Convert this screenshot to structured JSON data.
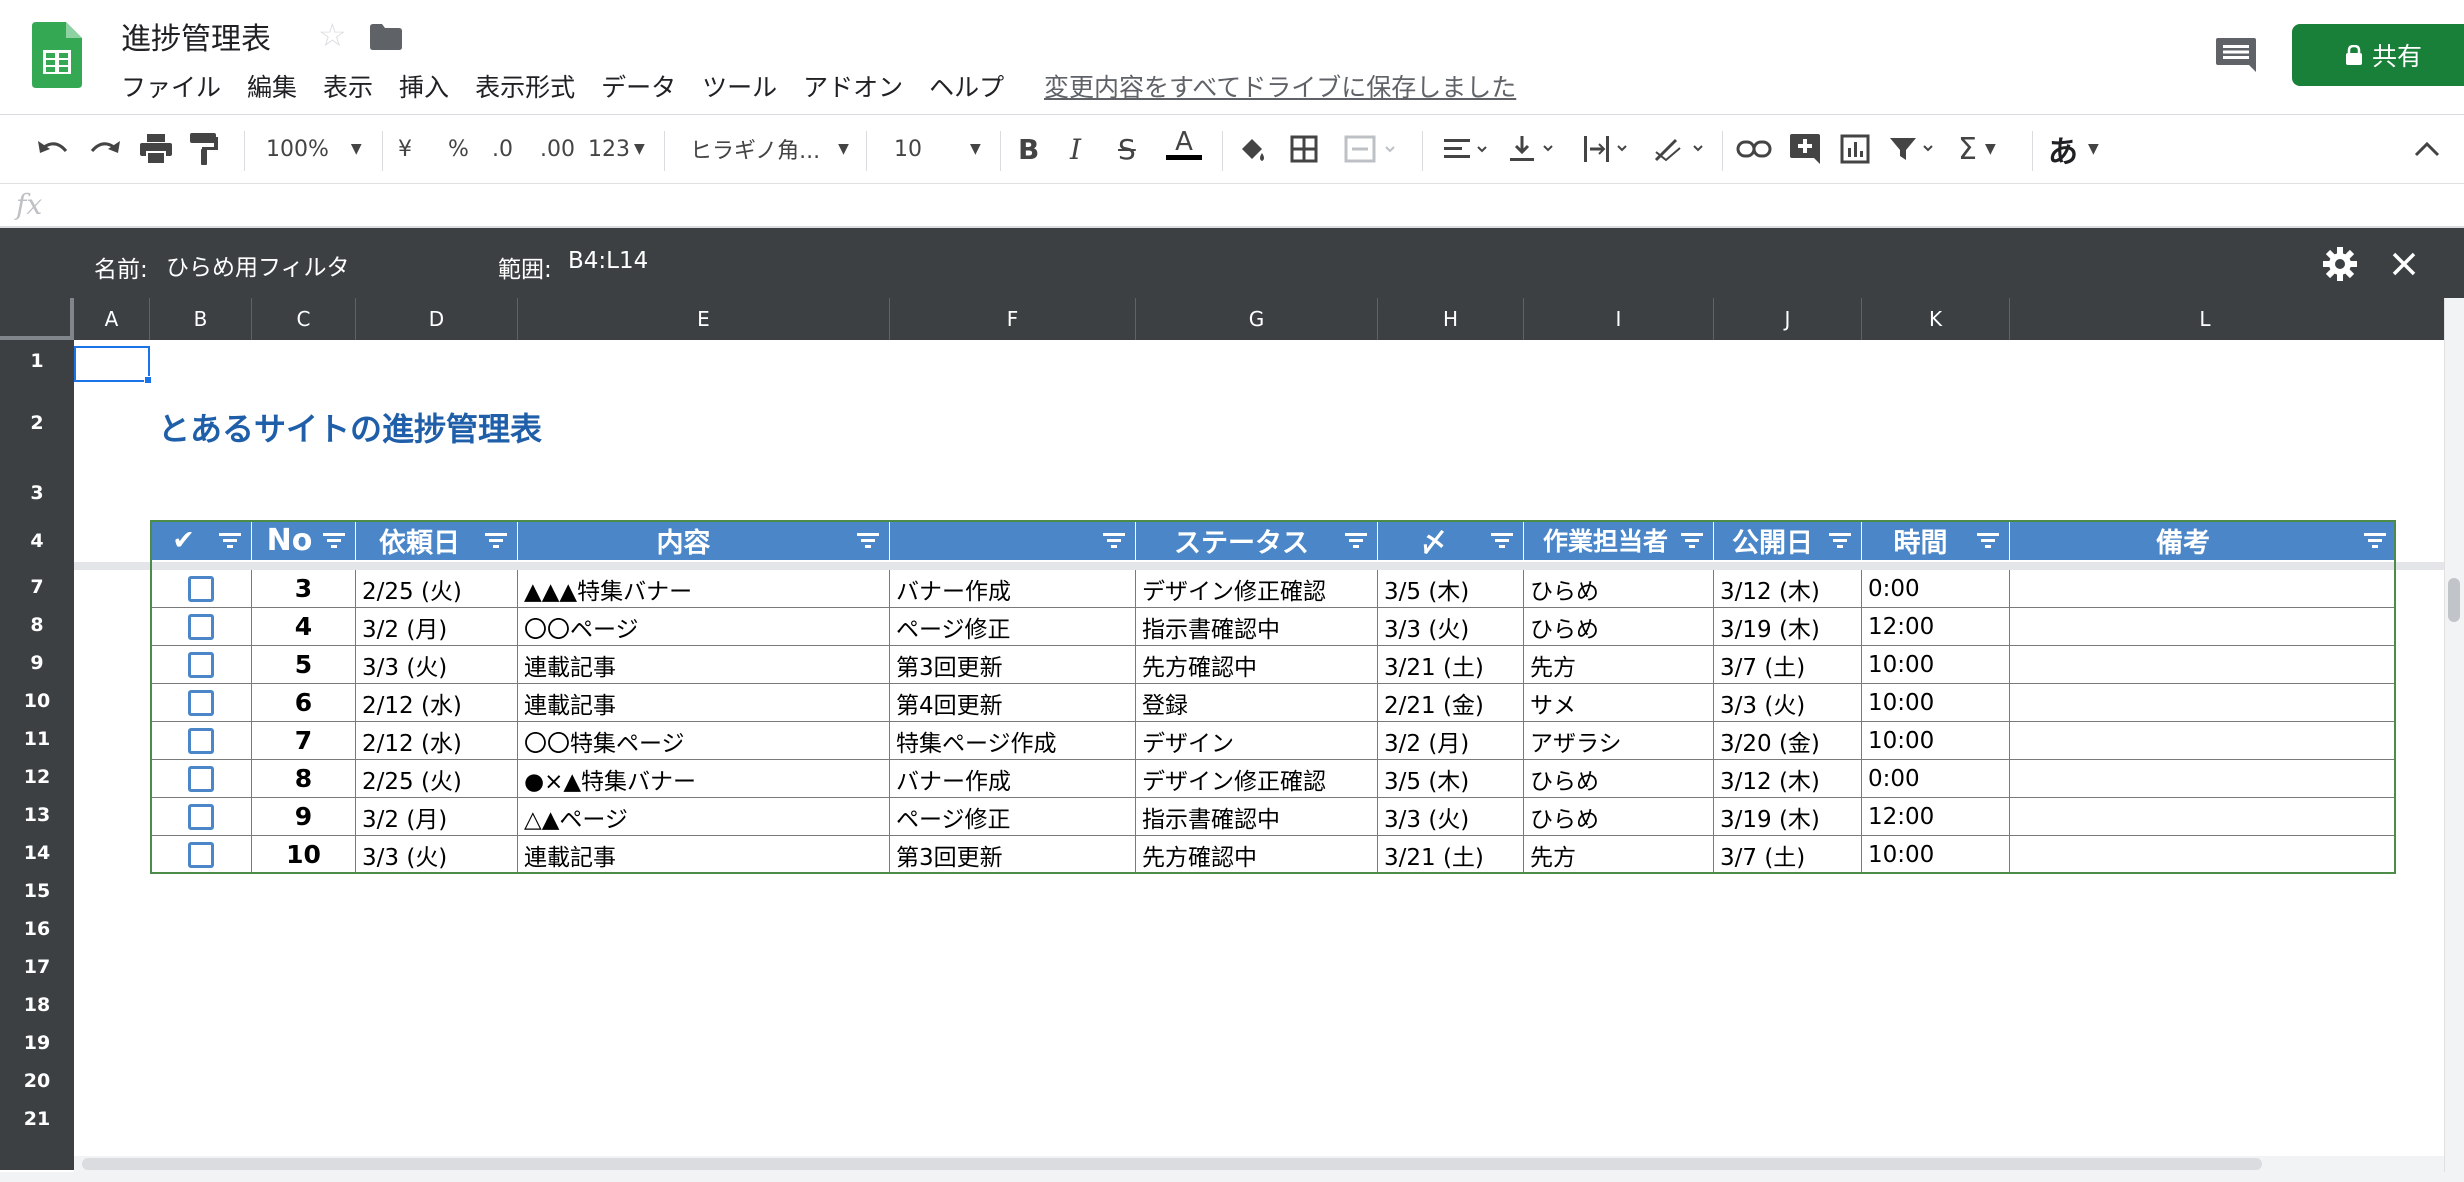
{
  "app": {
    "title": "進捗管理表",
    "menu": [
      "ファイル",
      "編集",
      "表示",
      "挿入",
      "表示形式",
      "データ",
      "ツール",
      "アドオン",
      "ヘルプ"
    ],
    "save_status": "変更内容をすべてドライブに保存しました",
    "share_label": "共有",
    "colors": {
      "brand_green": "#188038",
      "header_blue": "#4a86c8",
      "title_blue": "#1f5ea8",
      "dark_bar": "#3c4043"
    }
  },
  "toolbar": {
    "zoom": "100%",
    "currency": "¥",
    "percent": "%",
    "dec_decrease": ".0",
    "dec_increase": ".00",
    "format_more": "123",
    "font": "ヒラギノ角...",
    "font_size": "10",
    "input_tool": "あ",
    "icons": [
      "undo-icon",
      "redo-icon",
      "print-icon",
      "paint-format-icon",
      "bold-icon",
      "italic-icon",
      "strikethrough-icon",
      "text-color-icon",
      "fill-color-icon",
      "borders-icon",
      "merge-icon",
      "align-icon",
      "valign-icon",
      "wrap-icon",
      "rotate-icon",
      "link-icon",
      "comment-add-icon",
      "chart-icon",
      "filter-icon",
      "function-icon",
      "collapse-icon"
    ]
  },
  "formula_bar": {
    "fx": "fx",
    "value": ""
  },
  "filter_view": {
    "name_label": "名前:",
    "name": "ひらめ用フィルタ",
    "range_label": "範囲:",
    "range": "B4:L14"
  },
  "columns": [
    "A",
    "B",
    "C",
    "D",
    "E",
    "F",
    "G",
    "H",
    "I",
    "J",
    "K",
    "L"
  ],
  "rows": [
    "1",
    "2",
    "3",
    "4",
    "7",
    "8",
    "9",
    "10",
    "11",
    "12",
    "13",
    "14",
    "15",
    "16",
    "17",
    "18",
    "19",
    "20",
    "21"
  ],
  "sheet": {
    "title": "とあるサイトの進捗管理表",
    "headers": [
      "✔",
      "No",
      "依頼日",
      "内容",
      "",
      "ステータス",
      "〆",
      "作業担当者",
      "公開日",
      "時間",
      "備考"
    ],
    "table_rows": [
      {
        "no": "3",
        "requested": "2/25 (火)",
        "content": "▲▲▲特集バナー",
        "task": "バナー作成",
        "status": "デザイン修正確認",
        "deadline": "3/5 (木)",
        "assignee": "ひらめ",
        "publish": "3/12 (木)",
        "time": "0:00",
        "note": ""
      },
      {
        "no": "4",
        "requested": "3/2 (月)",
        "content": "〇〇ページ",
        "task": "ページ修正",
        "status": "指示書確認中",
        "deadline": "3/3 (火)",
        "assignee": "ひらめ",
        "publish": "3/19 (木)",
        "time": "12:00",
        "note": ""
      },
      {
        "no": "5",
        "requested": "3/3 (火)",
        "content": "連載記事",
        "task": "第3回更新",
        "status": "先方確認中",
        "deadline": "3/21 (土)",
        "assignee": "先方",
        "publish": "3/7 (土)",
        "time": "10:00",
        "note": ""
      },
      {
        "no": "6",
        "requested": "2/12 (水)",
        "content": "連載記事",
        "task": "第4回更新",
        "status": "登録",
        "deadline": "2/21 (金)",
        "assignee": "サメ",
        "publish": "3/3 (火)",
        "time": "10:00",
        "note": ""
      },
      {
        "no": "7",
        "requested": "2/12 (水)",
        "content": "〇〇特集ページ",
        "task": "特集ページ作成",
        "status": "デザイン",
        "deadline": "3/2 (月)",
        "assignee": "アザラシ",
        "publish": "3/20 (金)",
        "time": "10:00",
        "note": ""
      },
      {
        "no": "8",
        "requested": "2/25 (火)",
        "content": "●×▲特集バナー",
        "task": "バナー作成",
        "status": "デザイン修正確認",
        "deadline": "3/5 (木)",
        "assignee": "ひらめ",
        "publish": "3/12 (木)",
        "time": "0:00",
        "note": ""
      },
      {
        "no": "9",
        "requested": "3/2 (月)",
        "content": "△▲ページ",
        "task": "ページ修正",
        "status": "指示書確認中",
        "deadline": "3/3 (火)",
        "assignee": "ひらめ",
        "publish": "3/19 (木)",
        "time": "12:00",
        "note": ""
      },
      {
        "no": "10",
        "requested": "3/3 (火)",
        "content": "連載記事",
        "task": "第3回更新",
        "status": "先方確認中",
        "deadline": "3/21 (土)",
        "assignee": "先方",
        "publish": "3/7 (土)",
        "time": "10:00",
        "note": ""
      }
    ]
  }
}
